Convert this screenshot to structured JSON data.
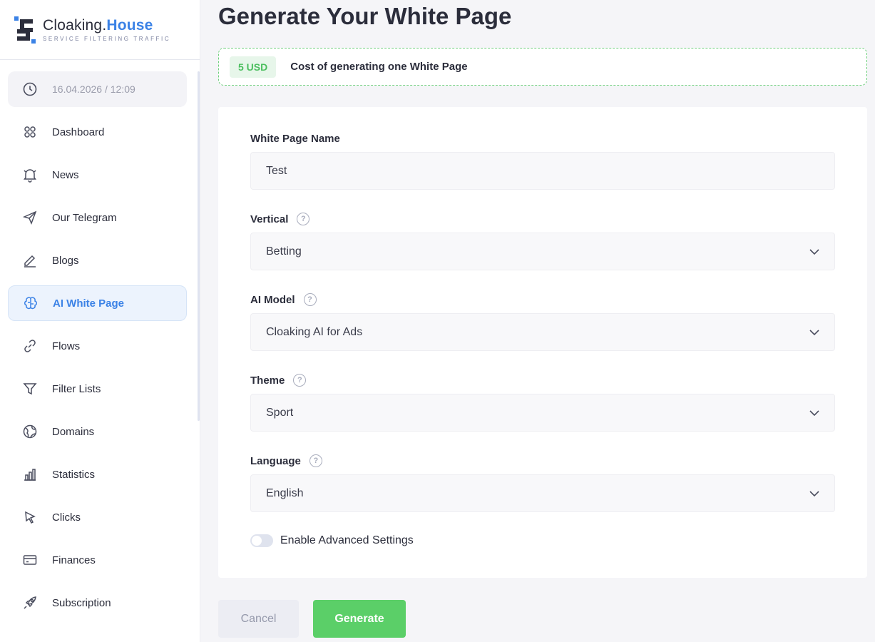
{
  "brand": {
    "name_part1": "Cloaking.",
    "name_part2": "House",
    "tagline": "SERVICE FILTERING TRAFFIC",
    "accent_color": "#3b82e6"
  },
  "sidebar": {
    "datetime": "16.04.2026 / 12:09",
    "items": [
      {
        "label": "Dashboard",
        "icon": "grid-icon"
      },
      {
        "label": "News",
        "icon": "bell-icon"
      },
      {
        "label": "Our Telegram",
        "icon": "send-icon"
      },
      {
        "label": "Blogs",
        "icon": "pencil-icon"
      },
      {
        "label": "AI White Page",
        "icon": "brain-icon",
        "active": true
      },
      {
        "label": "Flows",
        "icon": "link-icon"
      },
      {
        "label": "Filter Lists",
        "icon": "filter-icon"
      },
      {
        "label": "Domains",
        "icon": "globe-icon"
      },
      {
        "label": "Statistics",
        "icon": "bar-chart-icon"
      },
      {
        "label": "Clicks",
        "icon": "cursor-icon"
      },
      {
        "label": "Finances",
        "icon": "card-icon"
      },
      {
        "label": "Subscription",
        "icon": "rocket-icon"
      }
    ]
  },
  "main": {
    "title": "Generate Your White Page",
    "cost": {
      "badge": "5 USD",
      "text": "Cost of generating one White Page",
      "badge_color": "#4cbf5f"
    },
    "form": {
      "name_label": "White Page Name",
      "name_value": "Test",
      "vertical_label": "Vertical",
      "vertical_value": "Betting",
      "model_label": "AI Model",
      "model_value": "Cloaking AI for Ads",
      "theme_label": "Theme",
      "theme_value": "Sport",
      "language_label": "Language",
      "language_value": "English",
      "help_glyph": "?",
      "advanced_label": "Enable Advanced Settings",
      "advanced_enabled": false
    },
    "buttons": {
      "cancel": "Cancel",
      "generate": "Generate",
      "generate_color": "#5bcf68"
    }
  }
}
